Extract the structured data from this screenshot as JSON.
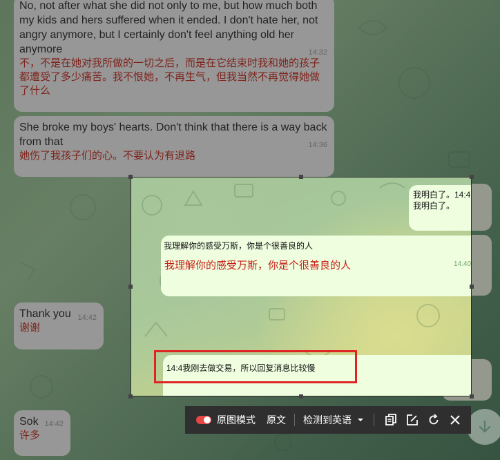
{
  "chat": {
    "msg1": {
      "text": "No, not after what she did not only to me, but how much both my kids and hers suffered when it ended. I don't hate her, not angry anymore, but I certainly don't feel anything old her anymore",
      "text_lines": [
        "No, not after what she did not only to me, but how much both",
        "my kids and hers suffered when it ended. I don't hate her, not",
        "angry anymore, but I certainly don't feel anything old her",
        "anymore"
      ],
      "translation_lines": [
        "不，不是在她对我所做的一切之后，而是在它结束时我和她的孩子",
        "都遭受了多少痛苦。我不恨她，不再生气，但我当然不再觉得她做",
        "了什么"
      ],
      "time": "14:32"
    },
    "msg2": {
      "text_lines": [
        "She broke my boys' hearts. Don't think that there is a way back",
        "from that"
      ],
      "translation": "她伤了我孩子们的心。不要认为有退路",
      "time": "14:36"
    },
    "msg3": {
      "text": "Thank you",
      "translation": "谢谢",
      "time": "14:42"
    },
    "msg4": {
      "text": "Sok",
      "translation": "许多",
      "time": "14:42"
    }
  },
  "capture": {
    "bubble1_lines": [
      "我明白了。14:4",
      "我明白了。"
    ],
    "bubble2": {
      "original": "我理解你的感受万斯，你是个很善良的人",
      "time": "14:40",
      "translated": "我理解你的感受万斯，你是个很善良的人"
    },
    "bubble3": {
      "text": "14:4我刚去做交易，所以回复消息比较慢"
    }
  },
  "toolbar": {
    "mode_label": "原图模式",
    "original_label": "原文",
    "detect_label": "检测到英语",
    "icons": [
      "copy-icon",
      "edit-icon",
      "refresh-icon",
      "close-icon"
    ]
  },
  "colors": {
    "translation_red": "#b42318",
    "toggle_red": "#e84545",
    "highlight_red": "#e02424",
    "outgoing_bubble": "#eefedf",
    "toolbar_bg": "#2f2f2f"
  }
}
